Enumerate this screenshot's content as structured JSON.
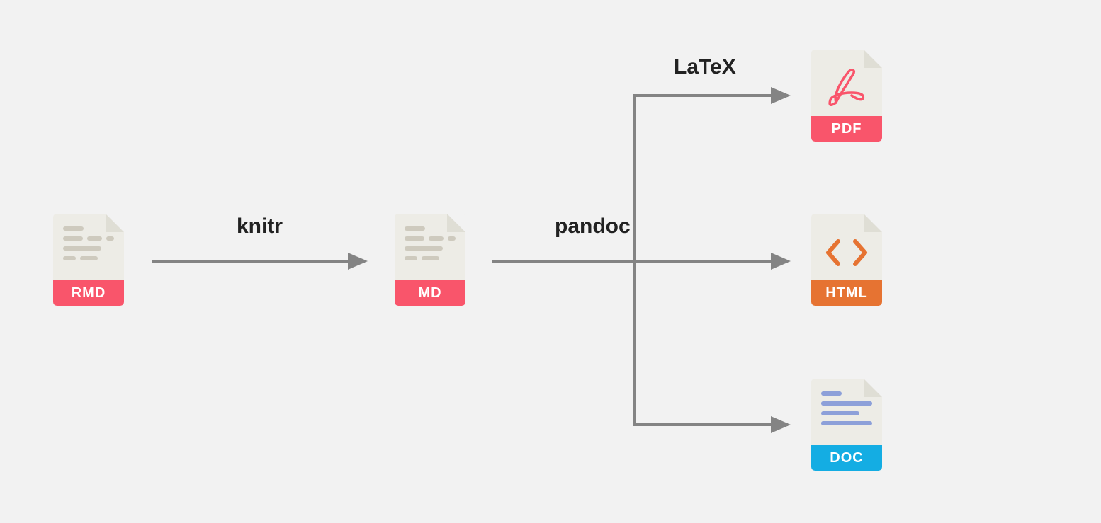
{
  "nodes": {
    "rmd": {
      "label": "RMD"
    },
    "md": {
      "label": "MD"
    },
    "pdf": {
      "label": "PDF"
    },
    "html": {
      "label": "HTML"
    },
    "doc": {
      "label": "DOC"
    }
  },
  "edges": {
    "knitr": "knitr",
    "pandoc": "pandoc",
    "latex": "LaTeX"
  },
  "colors": {
    "arrow": "#848484",
    "rmd_tag": "#f9556b",
    "md_tag": "#f9556b",
    "pdf_tag": "#f9556b",
    "html_tag": "#e67332",
    "doc_tag": "#14ade3"
  }
}
